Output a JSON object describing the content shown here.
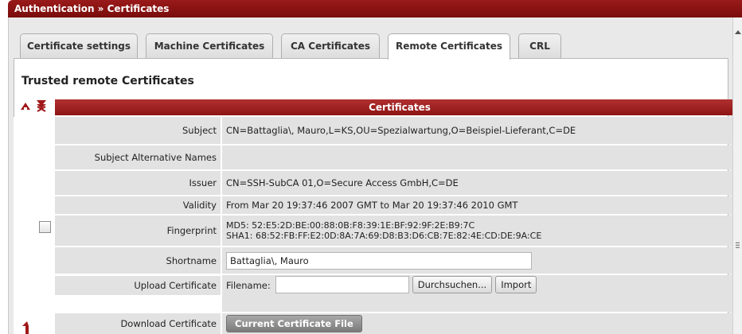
{
  "breadcrumb": "Authentication » Certificates",
  "tabs": [
    {
      "label": "Certificate settings",
      "active": false
    },
    {
      "label": "Machine Certificates",
      "active": false
    },
    {
      "label": "CA Certificates",
      "active": false
    },
    {
      "label": "Remote Certificates",
      "active": true
    },
    {
      "label": "CRL",
      "active": false
    }
  ],
  "section_title": "Trusted remote Certificates",
  "table": {
    "header": "Certificates",
    "subject_label": "Subject",
    "subject_value": "CN=Battaglia\\, Mauro,L=KS,OU=Spezialwartung,O=Beispiel-Lieferant,C=DE",
    "san_label": "Subject Alternative Names",
    "san_value": "",
    "issuer_label": "Issuer",
    "issuer_value": "CN=SSH-SubCA 01,O=Secure Access GmbH,C=DE",
    "validity_label": "Validity",
    "validity_value": "From Mar 20 19:37:46 2007 GMT to Mar 20 19:37:46 2010 GMT",
    "fingerprint_label": "Fingerprint",
    "fingerprint_md5": "MD5: 52:E5:2D:BE:00:88:0B:F8:39:1E:BF:92:9F:2E:B9:7C",
    "fingerprint_sha1": "SHA1: 68:52:FB:FF:E2:0D:8A:7A:69:D8:B3:D6:CB:7E:82:4E:CD:DE:9A:CE",
    "shortname_label": "Shortname",
    "shortname_value": "Battaglia\\, Mauro",
    "upload_label": "Upload Certificate",
    "filename_label": "Filename:",
    "filename_value": "",
    "browse_button": "Durchsuchen...",
    "import_button": "Import",
    "download_label": "Download Certificate",
    "download_button": "Current Certificate File"
  },
  "colors": {
    "brand": "#8e1414",
    "row_bg": "#e2e2e2",
    "panel_bg": "#e9e9e9"
  },
  "icons": {
    "add": "add-row-icon",
    "delete": "delete-row-icon",
    "move": "move-row-icon"
  }
}
